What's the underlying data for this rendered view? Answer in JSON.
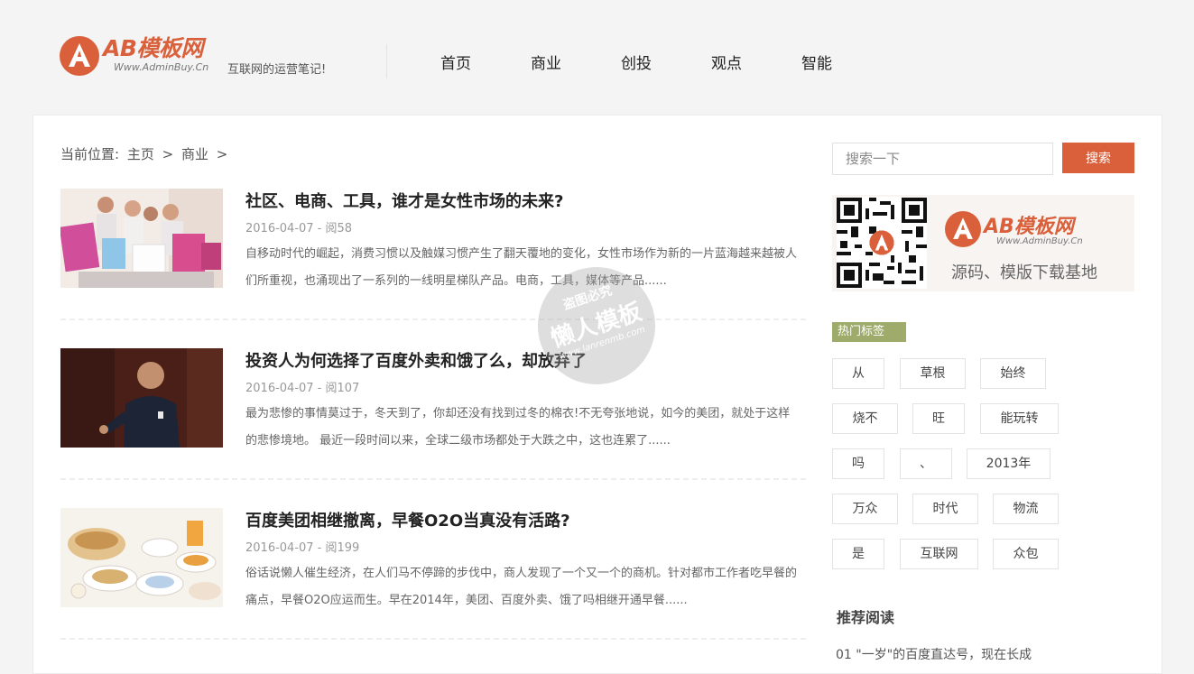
{
  "header": {
    "logo_text": "AB模板网",
    "logo_url": "Www.AdminBuy.Cn",
    "slogan": "互联网的运营笔记!",
    "nav": [
      {
        "label": "首页"
      },
      {
        "label": "商业"
      },
      {
        "label": "创投"
      },
      {
        "label": "观点"
      },
      {
        "label": "智能"
      }
    ]
  },
  "breadcrumb": {
    "prefix": "当前位置:",
    "items": [
      "主页",
      "商业"
    ],
    "separator": ">"
  },
  "articles": [
    {
      "title": "社区、电商、工具，谁才是女性市场的未来?",
      "meta": "2016-04-07 - 阅58",
      "summary": "自移动时代的崛起，消费习惯以及触媒习惯产生了翻天覆地的变化，女性市场作为新的一片蓝海越来越被人们所重视，也涌现出了一系列的一线明星梯队产品。电商，工具，媒体等产品......"
    },
    {
      "title": "投资人为何选择了百度外卖和饿了么，却放弃了",
      "meta": "2016-04-07 - 阅107",
      "summary": "最为悲惨的事情莫过于，冬天到了，你却还没有找到过冬的棉衣!不无夸张地说，如今的美团，就处于这样的悲惨境地。 最近一段时间以来，全球二级市场都处于大跌之中，这也连累了......"
    },
    {
      "title": "百度美团相继撤离，早餐O2O当真没有活路?",
      "meta": "2016-04-07 - 阅199",
      "summary": "俗话说懒人催生经济，在人们马不停蹄的步伐中，商人发现了一个又一个的商机。针对都市工作者吃早餐的痛点，早餐O2O应运而生。早在2014年，美团、百度外卖、饿了吗相继开通早餐......"
    }
  ],
  "sidebar": {
    "search_placeholder": "搜索一下",
    "search_button": "搜索",
    "banner": {
      "logo_text": "AB模板网",
      "logo_url": "Www.AdminBuy.Cn",
      "caption": "源码、模版下载基地"
    },
    "tags_heading": "热门标签",
    "tags": [
      "从",
      "草根",
      "始终",
      "烧不",
      "旺",
      "能玩转",
      "吗",
      "、",
      "2013年",
      "万众",
      "时代",
      "物流",
      "是",
      "互联网",
      "众包"
    ],
    "reco_heading": "推荐阅读",
    "reco_first": "01 \"一岁\"的百度直达号，现在长成"
  },
  "watermark": {
    "top": "盗图必究",
    "main": "懒人模板",
    "url": "www.lanrenmb.com"
  },
  "colors": {
    "accent": "#d9603b",
    "tag_heading": "#9eab6a",
    "page_bg": "#f4f4f4"
  }
}
